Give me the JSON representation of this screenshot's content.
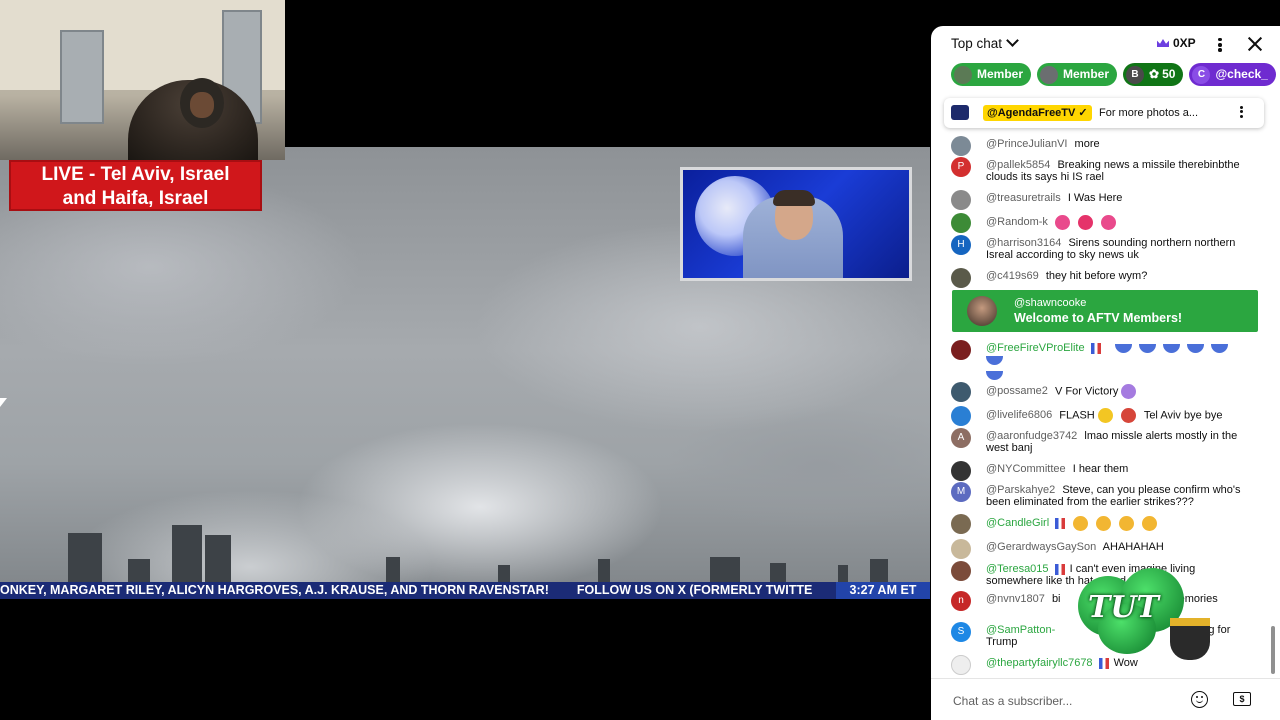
{
  "stream": {
    "banner_line1": "LIVE - Tel Aviv, Israel",
    "banner_line2": "and Haifa, Israel",
    "ticker_left": "ONKEY, MARGARET RILEY, ALICYN HARGROVES, A.J. KRAUSE, AND THORN RAVENSTAR!",
    "ticker_right": "FOLLOW US ON X (FORMERLY TWITTE",
    "ticker_time": "3:27 AM ET"
  },
  "chat": {
    "mode_label": "Top chat",
    "xp_label": "0XP",
    "chips": [
      {
        "label": "Member",
        "color": "#2ba640",
        "avatar": "#5b7a55"
      },
      {
        "label": "Member",
        "color": "#2ba640",
        "avatar": "#6b6e70"
      },
      {
        "label": "50",
        "color": "#107516",
        "avatar": "#4a4a4a",
        "avatar_letter": "B"
      },
      {
        "label": "@check_",
        "color": "#6f2bd0",
        "avatar": "#8a4de6",
        "avatar_letter": "C"
      }
    ],
    "pinned": {
      "author": "@AgendaFreeTV",
      "text": "For more photos a..."
    },
    "messages": [
      {
        "author": "@PrinceJulianVI",
        "text": "more",
        "avatar_color": "#7c8a96"
      },
      {
        "author": "@pallek5854",
        "text": "Breaking news a missile therebinbthe clouds its says hi IS rael",
        "avatar_color": "#d32f2f",
        "avatar_letter": "P"
      },
      {
        "author": "@treasuretrails",
        "text": "I Was Here",
        "avatar_color": "#8a8a8a"
      },
      {
        "author": "@Random-k",
        "text": "",
        "avatar_color": "#3d8b37"
      },
      {
        "author": "@harrison3164",
        "text": "Sirens sounding northern northern Isreal according to sky news uk",
        "avatar_color": "#1565c0",
        "avatar_letter": "H"
      },
      {
        "author": "@c419s69",
        "text": "they hit before wym?",
        "avatar_color": "#5a5a4a"
      },
      {
        "author": "@FreeFireVProElite",
        "text": "",
        "avatar_color": "#7a1e1e"
      },
      {
        "author": "@possame2",
        "text": "V For Victory",
        "avatar_color": "#3e5a6e"
      },
      {
        "author": "@livelife6806",
        "text": "FLASH",
        "text2": "Tel Aviv bye bye",
        "avatar_color": "#2a7fd4"
      },
      {
        "author": "@aaronfudge3742",
        "text": "lmao missle alerts mostly in the west banj",
        "avatar_color": "#8d6e63",
        "avatar_letter": "A"
      },
      {
        "author": "@NYCommittee",
        "text": "I hear them",
        "avatar_color": "#333333"
      },
      {
        "author": "@Parskahye2",
        "text": "Steve, can you please confirm who's been eliminated from the earlier strikes???",
        "avatar_color": "#5c6bc0",
        "avatar_letter": "M"
      },
      {
        "author": "@CandleGirl",
        "text": "",
        "avatar_color": "#7a6a52"
      },
      {
        "author": "@GerardwaysGaySon",
        "text": "AHAHAHAH",
        "avatar_color": "#c8b89a"
      },
      {
        "author": "@Teresa015",
        "text": "I can't even imagine living somewhere like th",
        "text2": "hat sound alert",
        "avatar_color": "#7b4b3a"
      },
      {
        "author": "@nvnv1807",
        "text": "bi",
        "text2": "M, damn memories",
        "avatar_color": "#c62828",
        "avatar_letter": "n"
      },
      {
        "author": "@SamPatton-",
        "text": "or voting for Trump",
        "avatar_color": "#1e88e5",
        "avatar_letter": "S"
      },
      {
        "author": "@thepartyfairyllc7678",
        "text": "Wow",
        "avatar_color": "#eeeeee"
      }
    ],
    "welcome": {
      "author": "@shawncooke",
      "text": "Welcome to AFTV Members!"
    },
    "sticker_text": "TUT",
    "input_placeholder": "Chat as a subscriber..."
  }
}
